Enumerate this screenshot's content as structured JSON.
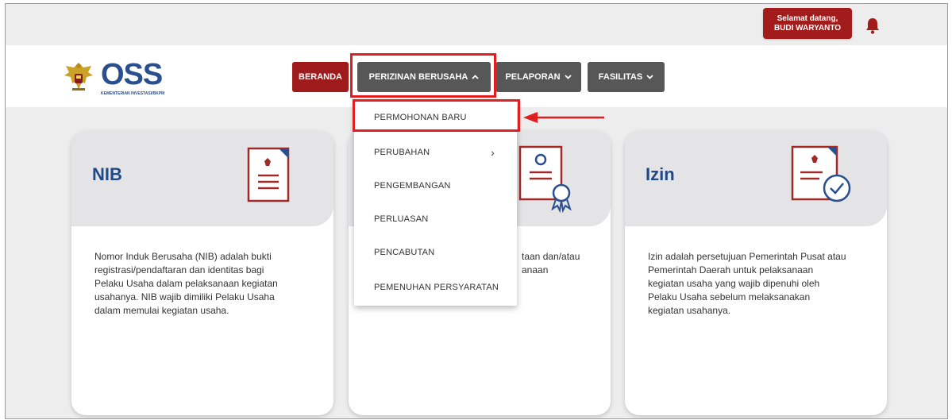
{
  "header": {
    "welcome_line1": "Selamat datang,",
    "welcome_line2": "BUDI WARYANTO",
    "notification_icon": "bell-icon"
  },
  "logo": {
    "wordmark": "OSS",
    "subtitle": "KEMENTERIAN INVESTASI/BKPM",
    "emblem_icon": "garuda-emblem-icon"
  },
  "nav": {
    "beranda": "BERANDA",
    "perizinan": "PERIZINAN BERUSAHA",
    "pelaporan": "PELAPORAN",
    "fasilitas": "FASILITAS"
  },
  "dropdown": {
    "items": [
      {
        "label": "PERMOHONAN BARU"
      },
      {
        "label": "PERUBAHAN",
        "has_submenu": true
      },
      {
        "label": "PENGEMBANGAN"
      },
      {
        "label": "PERLUASAN"
      },
      {
        "label": "PENCABUTAN"
      },
      {
        "label": "PEMENUHAN PERSYARATAN"
      }
    ]
  },
  "cards": {
    "nib": {
      "title": "NIB",
      "icon": "document-emblem-icon",
      "body": "Nomor Induk Berusaha (NIB) adalah bukti registrasi/pendaftaran dan identitas bagi Pelaku Usaha dalam pelaksanaan kegiatan usahanya. NIB wajib dimiliki Pelaku Usaha dalam memulai kegiatan usaha."
    },
    "middle": {
      "icon": "certificate-ribbon-icon",
      "body_line1": "taan dan/atau",
      "body_line2": "anaan"
    },
    "izin": {
      "title": "Izin",
      "icon": "document-check-icon",
      "body": "Izin adalah persetujuan Pemerintah Pusat atau Pemerintah Daerah untuk pelaksanaan kegiatan usaha yang wajib dipenuhi oleh Pelaku Usaha sebelum melaksanakan kegiatan usahanya."
    }
  },
  "colors": {
    "brand_red": "#a21c1c",
    "nav_gray": "#575757",
    "title_blue": "#1f4a8a",
    "annotation_red": "#e02020"
  }
}
